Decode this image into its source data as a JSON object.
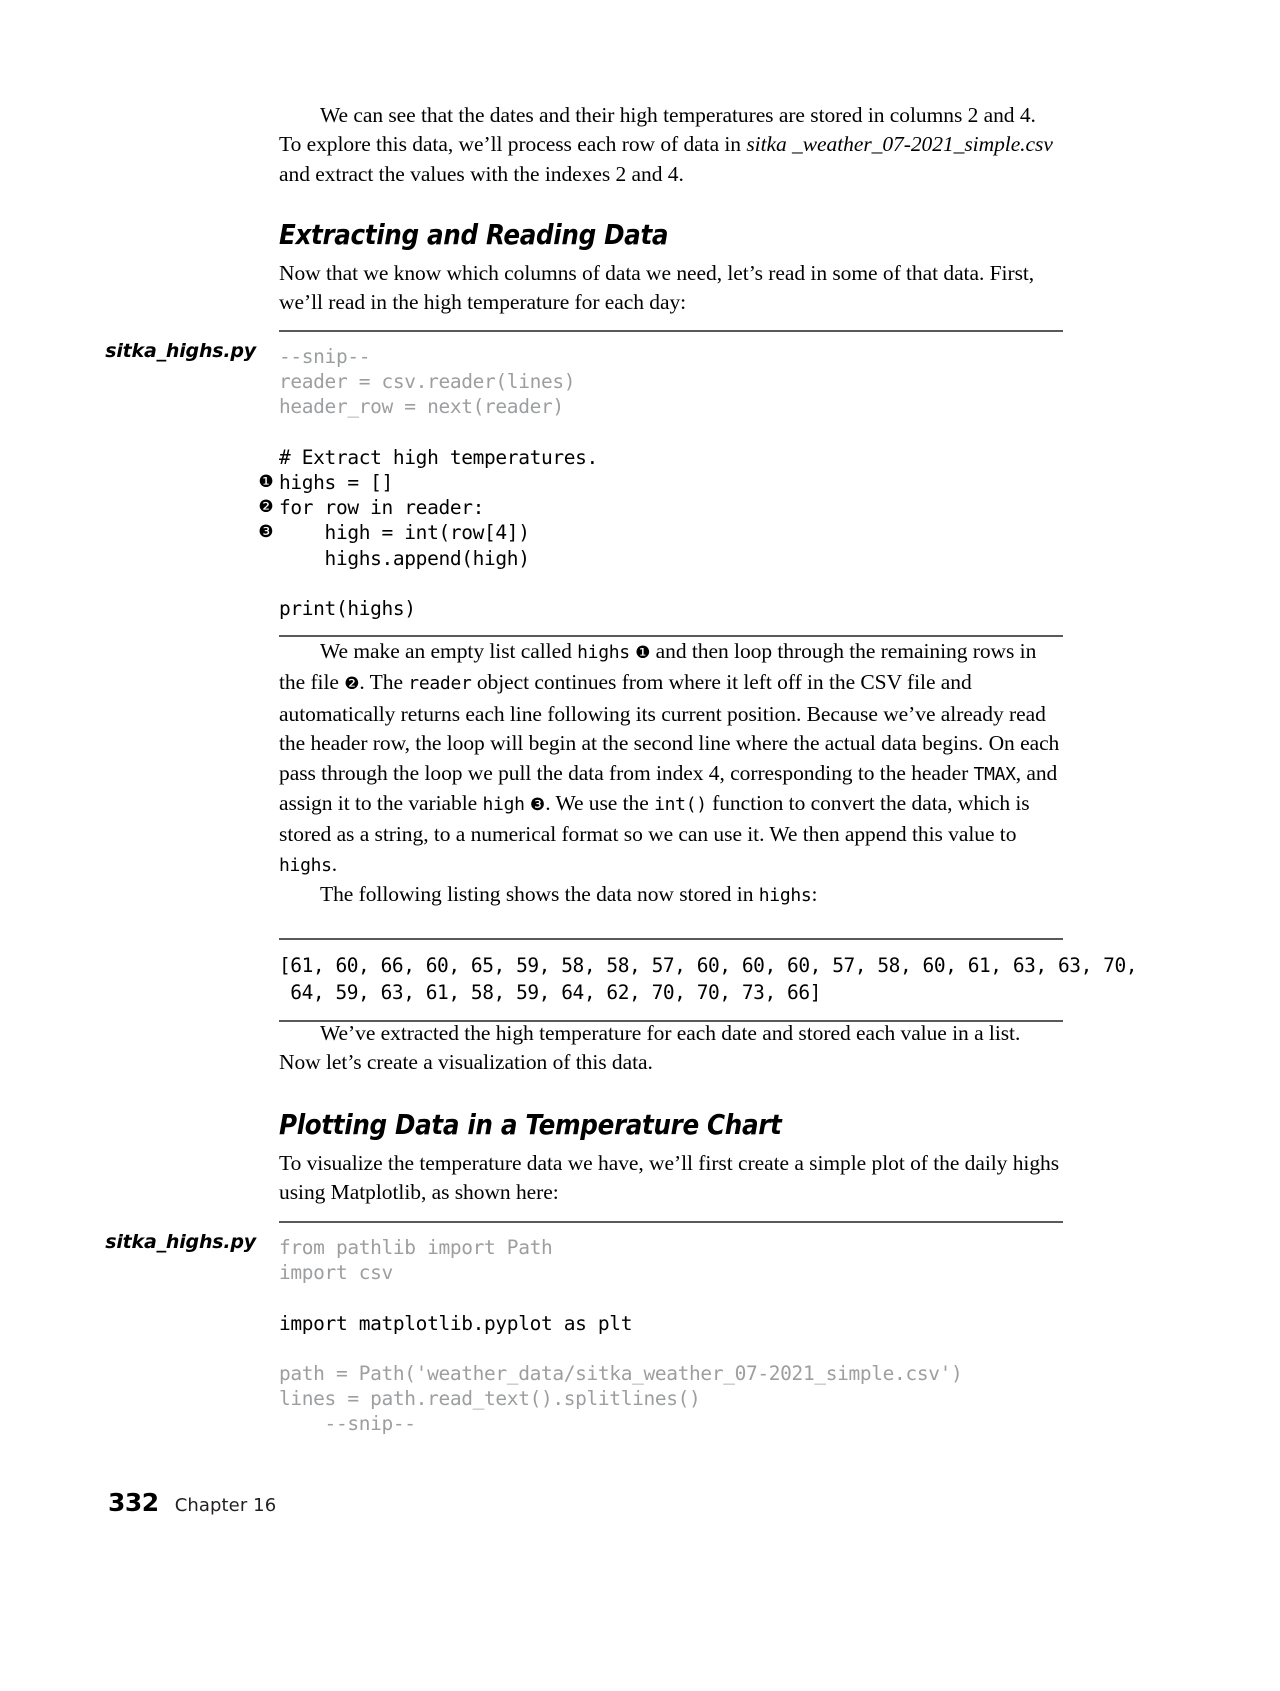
{
  "page": {
    "folio": "332",
    "running_head": "Chapter 16"
  },
  "intro_paragraph": {
    "part1": "We can see that the dates and their high temperatures are stored in columns 2 and 4. To explore this data, we’ll process each row of data in ",
    "italic1": "sitka _weather_07-2021_simple.csv",
    "part2": " and extract the values with the indexes 2 and 4."
  },
  "section1": {
    "heading": "Extracting and Reading Data",
    "intro": "Now that we know which columns of data we need, let’s read in some of that data. First, we’ll read in the high temperature for each day:",
    "file_label": "sitka_highs.py",
    "code": {
      "dim_lines": "--snip--\nreader = csv.reader(lines)\nheader_row = next(reader)",
      "body_lines": "# Extract high temperatures.\nhighs = []\nfor row in reader:\n    high = int(row[4])\n    highs.append(high)",
      "tail_line": "print(highs)",
      "bullets": [
        "❶",
        "❷",
        "❸"
      ]
    }
  },
  "explanation": {
    "p1_a": "We make an empty list called ",
    "p1_code1": "highs",
    "p1_b": " ",
    "p1_bullet1": "❶",
    "p1_c": " and then loop through the remaining rows in the file ",
    "p1_bullet2": "❷",
    "p1_d": ". The ",
    "p1_code2": "reader",
    "p1_e": " object continues from where it left off in the CSV file and automatically returns each line following its current position. Because we’ve already read the header row, the loop will begin at the second line where the actual data begins. On each pass through the loop we pull the data from index 4, corresponding to the header ",
    "p1_code3": "TMAX",
    "p1_f": ", and assign it to the variable ",
    "p1_code4": "high",
    "p1_g": " ",
    "p1_bullet3": "❸",
    "p1_h": ". We use the ",
    "p1_code5": "int()",
    "p1_i": " function to convert the data, which is stored as a string, to a numerical format so we can use it. We then append this value to ",
    "p1_code6": "highs",
    "p1_j": ".",
    "p2_a": "The following listing shows the data now stored in ",
    "p2_code": "highs",
    "p2_b": ":"
  },
  "output_listing": {
    "line1": "[61, 60, 66, 60, 65, 59, 58, 58, 57, 60, 60, 60, 57, 58, 60, 61, 63, 63, 70,",
    "line2": " 64, 59, 63, 61, 58, 59, 64, 62, 70, 70, 73, 66]",
    "values": [
      61,
      60,
      66,
      60,
      65,
      59,
      58,
      58,
      57,
      60,
      60,
      60,
      57,
      58,
      60,
      61,
      63,
      63,
      70,
      64,
      59,
      63,
      61,
      58,
      59,
      64,
      62,
      70,
      70,
      73,
      66
    ]
  },
  "after_output": "We’ve extracted the high temperature for each date and stored each value in a list. Now let’s create a visualization of this data.",
  "section2": {
    "heading": "Plotting Data in a Temperature Chart",
    "intro": "To visualize the temperature data we have, we’ll first create a simple plot of the daily highs using Matplotlib, as shown here:",
    "file_label": "sitka_highs.py",
    "code": {
      "dim_lines": "from pathlib import Path\nimport csv",
      "body_line": "import matplotlib.pyplot as plt",
      "dim_tail_line1": "path = Path('weather_data/sitka_weather_07-2021_simple.csv')",
      "dim_tail_line2": "lines = path.read_text().splitlines()",
      "dim_tail_line3": "    --snip--"
    }
  },
  "colors": {
    "rule": "#58595b",
    "dim_code": "#9c9ea0",
    "text": "#000000"
  }
}
